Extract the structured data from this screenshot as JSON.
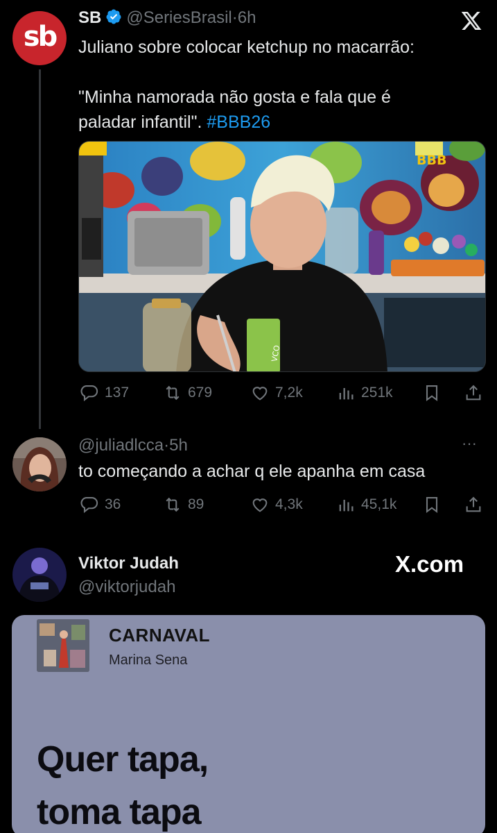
{
  "post1": {
    "name": "SB",
    "handle": "@SeriesBrasil",
    "time": "6h",
    "line1": "Juliano sobre colocar ketchup no macarrão:",
    "line2": "\"Minha namorada não gosta e fala que é",
    "line3": "paladar infantil\". ",
    "hashtag": "#BBB26",
    "media_badge": "BBB",
    "bottle_label": "VCO",
    "stats": {
      "replies": "137",
      "reposts": "679",
      "likes": "7,2k",
      "views": "251k"
    }
  },
  "post2": {
    "handle": "@juliadlcca",
    "time": "5h",
    "text": "to começando a achar q ele apanha em casa",
    "more": "···",
    "stats": {
      "replies": "36",
      "reposts": "89",
      "likes": "4,3k",
      "views": "45,1k"
    }
  },
  "post3": {
    "name": "Viktor Judah",
    "handle": "@viktorjudah",
    "watermark": "X.com",
    "card": {
      "song": "CARNAVAL",
      "artist": "Marina Sena",
      "lyric_line1": "Quer tapa,",
      "lyric_line2": "toma tapa"
    }
  },
  "separator": "·",
  "colors": {
    "accent": "#1d9bf0",
    "muted": "#71767b",
    "brand_red": "#c8252c",
    "card_bg": "#8a8fab"
  },
  "icons": [
    "x-logo-icon",
    "verified-badge-icon",
    "reply-icon",
    "repost-icon",
    "like-icon",
    "views-icon",
    "bookmark-icon",
    "share-icon",
    "more-icon"
  ]
}
